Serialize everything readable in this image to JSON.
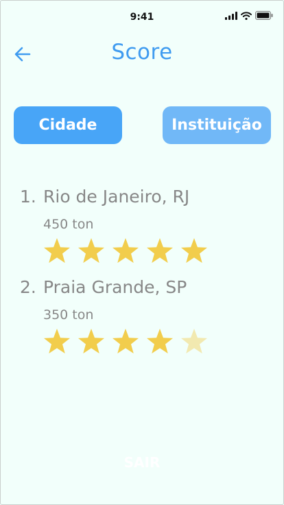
{
  "status_bar": {
    "time": "9:41"
  },
  "header": {
    "title": "Score"
  },
  "tabs": [
    {
      "label": "Cidade",
      "active": true
    },
    {
      "label": "Instituição",
      "active": false
    }
  ],
  "ranking": [
    {
      "position": "1.",
      "name": "Rio de Janeiro, RJ",
      "amount": "450 ton",
      "rating": 5,
      "max_rating": 5
    },
    {
      "position": "2.",
      "name": "Praia Grande, SP",
      "amount": "350 ton",
      "rating": 4,
      "max_rating": 5
    }
  ],
  "footer": {
    "exit_label": "SAIR"
  },
  "colors": {
    "accent": "#3f9bf0",
    "tab_active": "#48a5f7",
    "tab_inactive": "#71b8f7",
    "star_filled": "#f2cd4c",
    "star_empty": "#f2e9b0",
    "background": "#f2fffb"
  }
}
